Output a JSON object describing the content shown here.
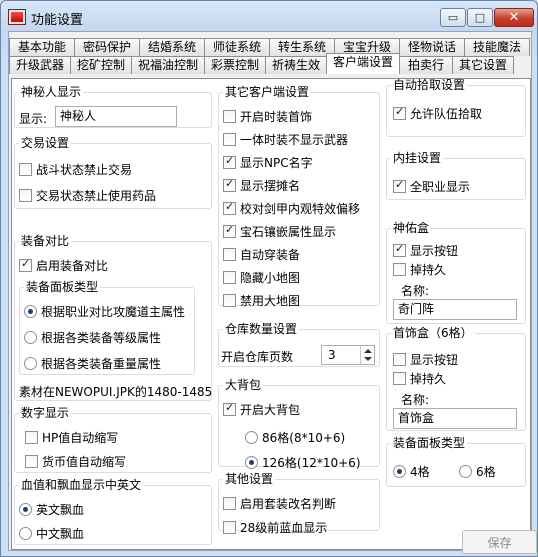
{
  "window": {
    "title": "功能设置",
    "controls": {
      "minimize": "▭",
      "maximize": "□",
      "close": "✕"
    }
  },
  "tabs": {
    "row1": [
      "基本功能",
      "密码保护",
      "结婚系统",
      "师徒系统",
      "转生系统",
      "宝宝升级",
      "怪物说话",
      "技能魔法"
    ],
    "row2": [
      "升级武器",
      "挖矿控制",
      "祝福油控制",
      "彩票控制",
      "祈祷生效",
      "客户端设置",
      "拍卖行",
      "其它设置"
    ],
    "active": "客户端设置"
  },
  "mystery": {
    "title": "神秘人显示",
    "label": "显示:",
    "value": "神秘人"
  },
  "trade": {
    "title": "交易设置",
    "items": [
      "战斗状态禁止交易",
      "交易状态禁止使用药品"
    ]
  },
  "compare": {
    "title": "装备对比",
    "enable": "启用装备对比",
    "panel_title": "装备面板类型",
    "options": [
      "根据职业对比攻魔道主属性",
      "根据各类装备等级属性",
      "根据各类装备重量属性"
    ],
    "note": "素材在NEWOPUI.JPK的1480-1485"
  },
  "numeric": {
    "title": "数字显示",
    "items": [
      "HP值自动缩写",
      "货币值自动缩写"
    ]
  },
  "blood_lang": {
    "title": "血值和飘血显示中英文",
    "options": [
      "英文飘血",
      "中文飘血"
    ]
  },
  "client_other": {
    "title": "其它客户端设置",
    "items": [
      {
        "label": "开启时装首饰",
        "checked": false
      },
      {
        "label": "一体时装不显示武器",
        "checked": false
      },
      {
        "label": "显示NPC名字",
        "checked": true
      },
      {
        "label": "显示摆摊名",
        "checked": true
      },
      {
        "label": "校对剑甲内观特效偏移",
        "checked": true
      },
      {
        "label": "宝石镶嵌属性显示",
        "checked": true
      },
      {
        "label": "自动穿装备",
        "checked": false
      },
      {
        "label": "隐藏小地图",
        "checked": false
      },
      {
        "label": "禁用大地图",
        "checked": false
      }
    ]
  },
  "storage": {
    "title": "仓库数量设置",
    "label": "开启仓库页数",
    "value": "3"
  },
  "bigbag": {
    "title": "大背包",
    "enable": "开启大背包",
    "options": [
      "86格(8*10+6)",
      "126格(12*10+6)"
    ]
  },
  "other": {
    "title": "其他设置",
    "items": [
      "启用套装改名判断",
      "28级前蓝血显示"
    ]
  },
  "autopick": {
    "title": "自动拾取设置",
    "item": "允许队伍拾取"
  },
  "plugin": {
    "title": "内挂设置",
    "item": "全职业显示"
  },
  "shenyou": {
    "title": "神佑盒",
    "items": [
      "显示按钮",
      "掉持久"
    ],
    "name_label": "名称:",
    "name_value": "奇门阵"
  },
  "shoushi": {
    "title": "首饰盒（6格）",
    "items": [
      "显示按钮",
      "掉持久"
    ],
    "name_label": "名称:",
    "name_value": "首饰盒"
  },
  "equip_panel": {
    "title": "装备面板类型",
    "options": [
      "4格",
      "6格"
    ]
  },
  "save": "保存"
}
